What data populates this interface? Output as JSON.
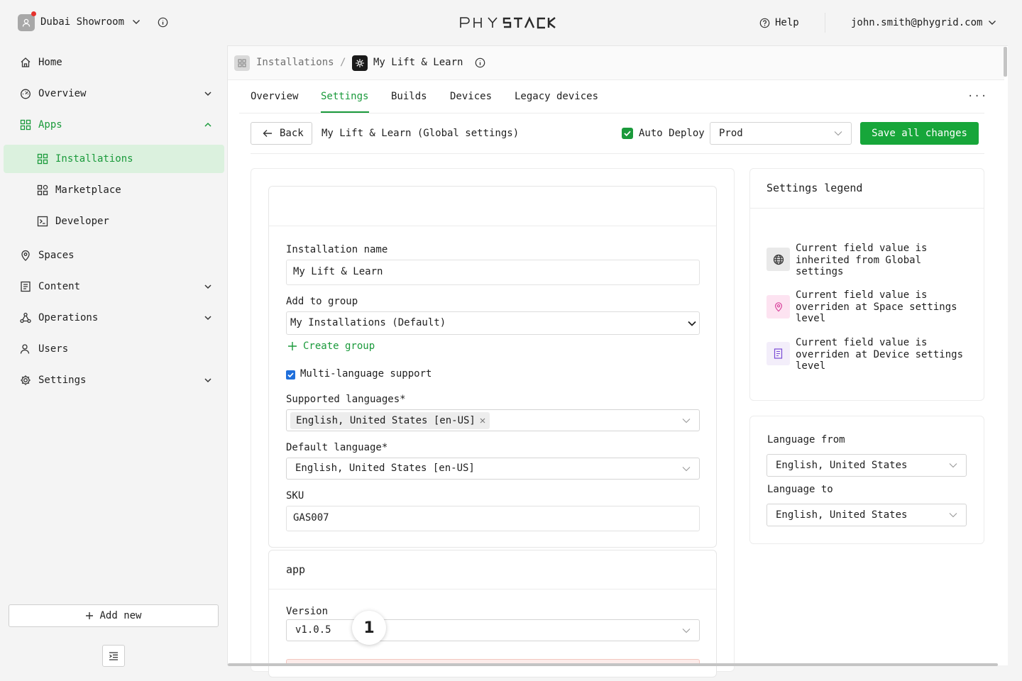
{
  "workspace": {
    "name": "Dubai Showroom"
  },
  "brand": {
    "logo_text": "PHYSTACK"
  },
  "topbar": {
    "help_label": "Help",
    "user_email": "john.smith@phygrid.com"
  },
  "sidebar": {
    "items": [
      {
        "label": "Home",
        "icon": "home-icon"
      },
      {
        "label": "Overview",
        "icon": "gauge-icon"
      },
      {
        "label": "Apps",
        "icon": "apps-grid-icon"
      },
      {
        "label": "Installations",
        "icon": "apps-grid-icon"
      },
      {
        "label": "Marketplace",
        "icon": "marketplace-icon"
      },
      {
        "label": "Developer",
        "icon": "terminal-icon"
      },
      {
        "label": "Spaces",
        "icon": "location-pin-icon"
      },
      {
        "label": "Content",
        "icon": "document-icon"
      },
      {
        "label": "Operations",
        "icon": "network-icon"
      },
      {
        "label": "Users",
        "icon": "user-icon"
      },
      {
        "label": "Settings",
        "icon": "gear-icon"
      }
    ],
    "add_new_label": "Add new"
  },
  "breadcrumb": {
    "root": "Installations",
    "separator": "/",
    "current": "My Lift & Learn"
  },
  "tabs": [
    "Overview",
    "Settings",
    "Builds",
    "Devices",
    "Legacy devices"
  ],
  "tabs_more": "···",
  "toolbar": {
    "back_label": "Back",
    "title": "My Lift & Learn (Global settings)",
    "auto_deploy_label": "Auto Deploy",
    "auto_deploy_checked": true,
    "environment": "Prod",
    "save_label": "Save all changes"
  },
  "form": {
    "installation_name_label": "Installation name",
    "installation_name_value": "My Lift & Learn",
    "group_label": "Add to group",
    "group_value": "My Installations (Default)",
    "create_group_label": "Create group",
    "multilang_label": "Multi-language support",
    "multilang_checked": true,
    "supported_languages_label": "Supported languages*",
    "supported_languages": [
      "English, United States [en-US]"
    ],
    "default_language_label": "Default language*",
    "default_language_value": "English, United States [en-US]",
    "sku_label": "SKU",
    "sku_value": "GAS007",
    "app_section_title": "app",
    "version_label": "Version",
    "version_value": "v1.0.5",
    "step_badge": "1"
  },
  "legend": {
    "title": "Settings legend",
    "items": [
      {
        "icon": "globe-icon",
        "text": "Current field value is inherited from Global settings",
        "color": "#e9e9e9"
      },
      {
        "icon": "location-pin-icon",
        "text": "Current field value is overriden at Space settings level",
        "color": "#fde3f1"
      },
      {
        "icon": "device-icon",
        "text": "Current field value is overriden at Device settings level",
        "color": "#f3eefa"
      }
    ]
  },
  "language": {
    "from_label": "Language from",
    "from_value": "English, United States",
    "to_label": "Language to",
    "to_value": "English, United States"
  },
  "colors": {
    "accent": "#1a9a3b",
    "accent_bg": "#dbf1de",
    "save_button": "#17a63a"
  }
}
